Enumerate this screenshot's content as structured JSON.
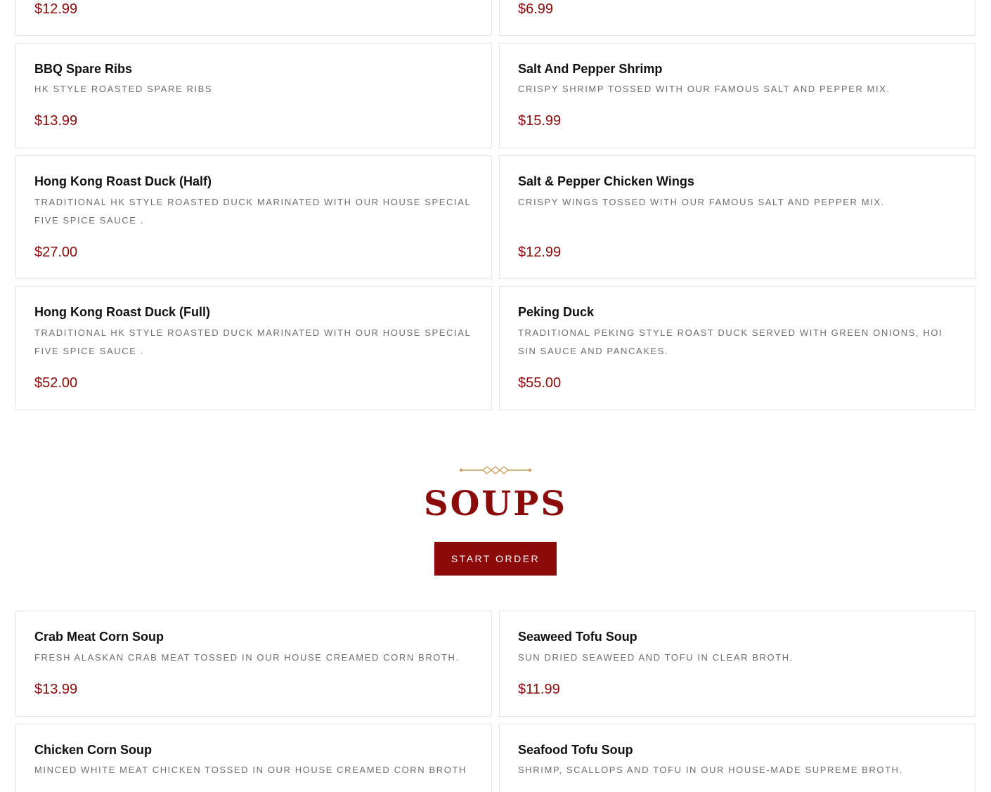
{
  "top_cards": {
    "left_price": "$12.99",
    "right_price": "$6.99"
  },
  "items": [
    {
      "name": "BBQ Spare Ribs",
      "desc": "HK style roasted spare ribs",
      "price": "$13.99"
    },
    {
      "name": "Salt And Pepper Shrimp",
      "desc": "Crispy shrimp tossed with our famous salt and pepper mix.",
      "price": "$15.99"
    },
    {
      "name": "Hong Kong Roast Duck (Half)",
      "desc": "Traditional HK style roasted duck marinated with our house special five spice sauce .",
      "price": "$27.00"
    },
    {
      "name": "Salt & Pepper Chicken Wings",
      "desc": "Crispy wings tossed with our famous salt and pepper mix.",
      "price": "$12.99"
    },
    {
      "name": "Hong Kong Roast Duck (Full)",
      "desc": "Traditional HK style roasted duck marinated with our house special five spice sauce .",
      "price": "$52.00"
    },
    {
      "name": "Peking Duck",
      "desc": "Traditional Peking style roast duck served with green onions, hoi sin sauce and pancakes.",
      "price": "$55.00"
    }
  ],
  "soups_section": {
    "title": "SOUPS",
    "button_label": "Start Order"
  },
  "soups": [
    {
      "name": "Crab Meat Corn Soup",
      "desc": "Fresh Alaskan crab meat tossed in our house creamed corn broth.",
      "price": "$13.99"
    },
    {
      "name": "Seaweed Tofu Soup",
      "desc": "Sun dried seaweed and tofu in clear broth.",
      "price": "$11.99"
    },
    {
      "name": "Chicken Corn Soup",
      "desc": "Minced white meat chicken tossed in our house creamed corn broth"
    },
    {
      "name": "Seafood Tofu Soup",
      "desc": "Shrimp, scallops and tofu in our house-made supreme broth."
    }
  ],
  "colors": {
    "accent": "#8b0a0a",
    "ornament": "#c9a063",
    "border": "#e6e6e6",
    "desc_text": "#6d6d6d"
  }
}
